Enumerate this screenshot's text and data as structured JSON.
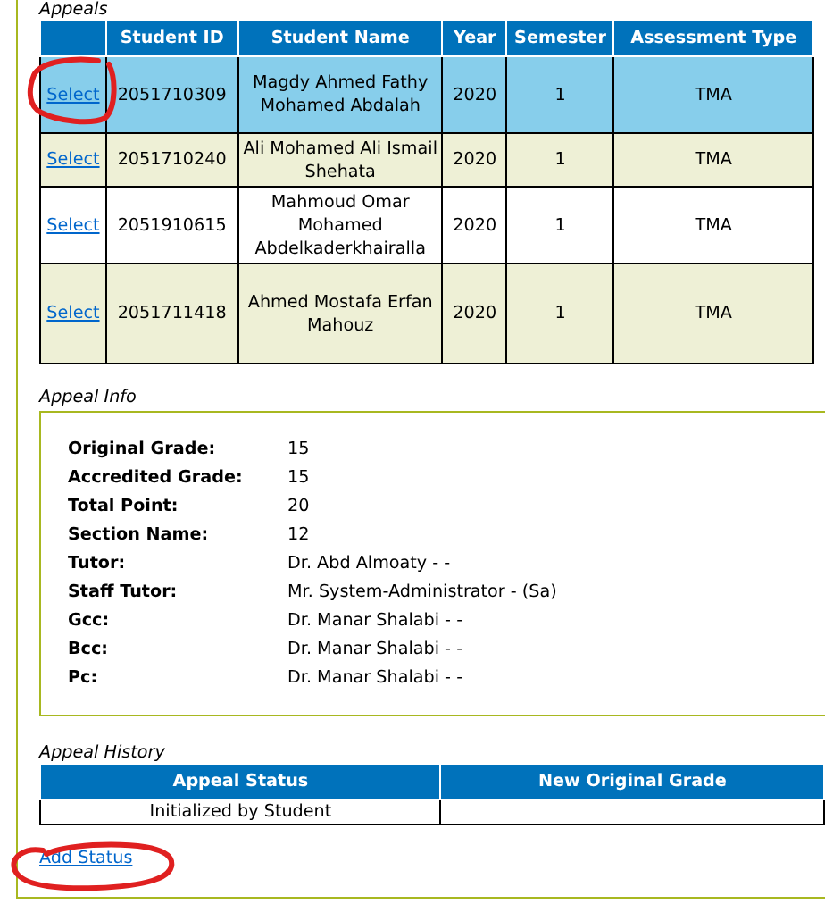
{
  "appeals": {
    "legend": "Appeals",
    "columns": [
      "Student ID",
      "Student Name",
      "Year",
      "Semester",
      "Assessment Type"
    ],
    "rows": [
      {
        "link": "Select",
        "selected": true,
        "cells": [
          "2051710309",
          "Magdy Ahmed Fathy Mohamed Abdalah",
          "2020",
          "1",
          "TMA"
        ]
      },
      {
        "link": "Select",
        "selected": false,
        "cells": [
          "2051710240",
          "Ali Mohamed Ali Ismail Shehata",
          "2020",
          "1",
          "TMA"
        ]
      },
      {
        "link": "Select",
        "selected": false,
        "cells": [
          "2051910615",
          "Mahmoud Omar Mohamed Abdelkaderkhairalla",
          "2020",
          "1",
          "TMA"
        ]
      },
      {
        "link": "Select",
        "selected": false,
        "cells": [
          "2051711418",
          "Ahmed Mostafa Erfan Mahouz",
          "2020",
          "1",
          "TMA"
        ]
      }
    ]
  },
  "appeal_info": {
    "legend": "Appeal Info",
    "fields": [
      {
        "label": "Original Grade:",
        "value": "15"
      },
      {
        "label": "Accredited Grade:",
        "value": "15"
      },
      {
        "label": "Total Point:",
        "value": "20"
      },
      {
        "label": "Section Name:",
        "value": "12"
      },
      {
        "label": "Tutor:",
        "value": "Dr. Abd Almoaty - -"
      },
      {
        "label": "Staff Tutor:",
        "value": "Mr. System-Administrator - (Sa)"
      },
      {
        "label": "Gcc:",
        "value": "Dr. Manar Shalabi - -"
      },
      {
        "label": "Bcc:",
        "value": "Dr. Manar Shalabi - -"
      },
      {
        "label": "Pc:",
        "value": "Dr. Manar Shalabi - -"
      }
    ]
  },
  "appeal_history": {
    "legend": "Appeal History",
    "columns": [
      "Appeal Status",
      "New Original Grade"
    ],
    "rows": [
      [
        "Initialized by Student",
        ""
      ]
    ]
  },
  "add_status_link": "Add Status"
}
